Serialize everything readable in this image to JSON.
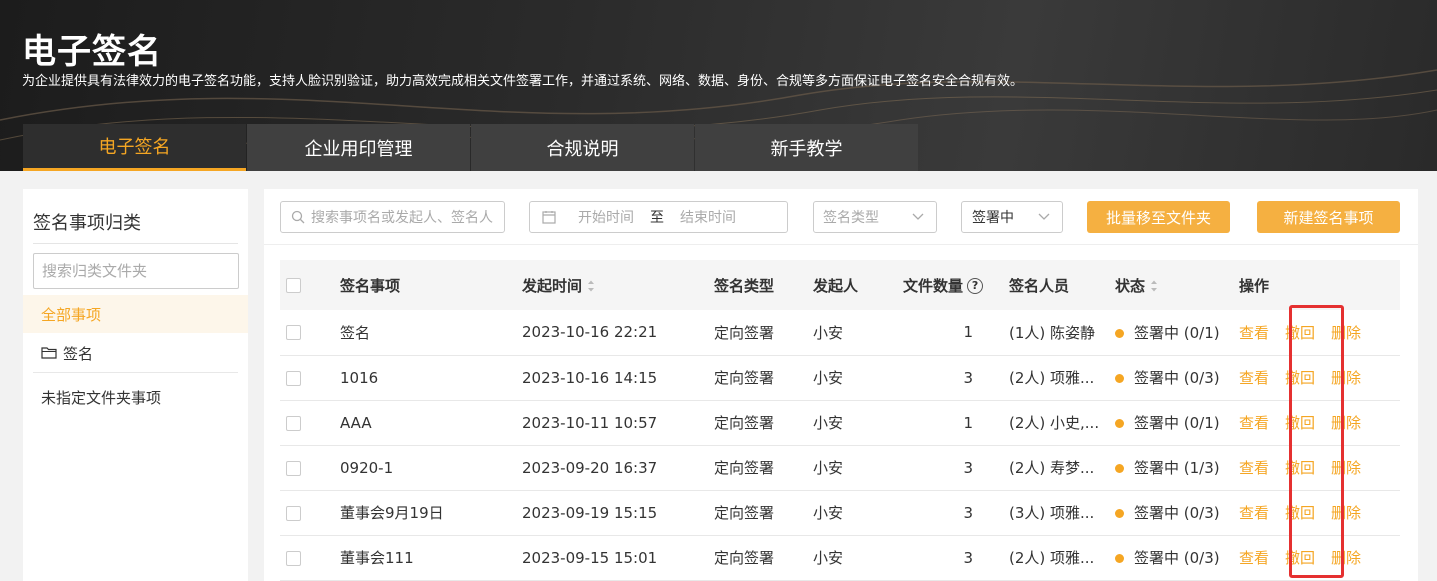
{
  "banner": {
    "title": "电子签名",
    "description": "为企业提供具有法律效力的电子签名功能，支持人脸识别验证，助力高效完成相关文件签署工作，并通过系统、网络、数据、身份、合规等多方面保证电子签名安全合规有效。"
  },
  "tabs": [
    {
      "label": "电子签名",
      "active": true
    },
    {
      "label": "企业用印管理",
      "active": false
    },
    {
      "label": "合规说明",
      "active": false
    },
    {
      "label": "新手教学",
      "active": false
    }
  ],
  "sidebar": {
    "title": "签名事项归类",
    "search_placeholder": "搜索归类文件夹",
    "items": [
      {
        "label": "全部事项",
        "active": true,
        "icon": ""
      },
      {
        "label": "签名",
        "active": false,
        "icon": "folder-icon"
      },
      {
        "label": "未指定文件夹事项",
        "active": false,
        "icon": ""
      }
    ]
  },
  "toolbar": {
    "search_placeholder": "搜索事项名或发起人、签名人",
    "date_start": "开始时间",
    "date_to": "至",
    "date_end": "结束时间",
    "type_select": "签名类型",
    "status_select": "签署中",
    "batch_button": "批量移至文件夹",
    "new_button": "新建签名事项"
  },
  "table": {
    "headers": {
      "item": "签名事项",
      "time": "发起时间",
      "type": "签名类型",
      "initiator": "发起人",
      "files": "文件数量",
      "signers": "签名人员",
      "status": "状态",
      "actions": "操作"
    },
    "action_labels": {
      "view": "查看",
      "revoke": "撤回",
      "delete": "删除"
    },
    "rows": [
      {
        "item": "签名",
        "time": "2023-10-16 22:21",
        "type": "定向签署",
        "initiator": "小安",
        "files": "1",
        "signers": "(1人) 陈姿静",
        "status": "签署中 (0/1)"
      },
      {
        "item": "1016",
        "time": "2023-10-16 14:15",
        "type": "定向签署",
        "initiator": "小安",
        "files": "3",
        "signers": "(2人) 项雅...",
        "status": "签署中 (0/3)"
      },
      {
        "item": "AAA",
        "time": "2023-10-11 10:57",
        "type": "定向签署",
        "initiator": "小安",
        "files": "1",
        "signers": "(2人) 小史,...",
        "status": "签署中 (0/1)"
      },
      {
        "item": "0920-1",
        "time": "2023-09-20 16:37",
        "type": "定向签署",
        "initiator": "小安",
        "files": "3",
        "signers": "(2人) 寿梦...",
        "status": "签署中 (1/3)"
      },
      {
        "item": "董事会9月19日",
        "time": "2023-09-19 15:15",
        "type": "定向签署",
        "initiator": "小安",
        "files": "3",
        "signers": "(3人) 项雅...",
        "status": "签署中 (0/3)"
      },
      {
        "item": "董事会111",
        "time": "2023-09-15 15:01",
        "type": "定向签署",
        "initiator": "小安",
        "files": "3",
        "signers": "(2人) 项雅...",
        "status": "签署中 (0/3)"
      }
    ]
  },
  "colors": {
    "accent": "#f5a623",
    "button": "#f5b041",
    "highlight": "#e53030"
  }
}
